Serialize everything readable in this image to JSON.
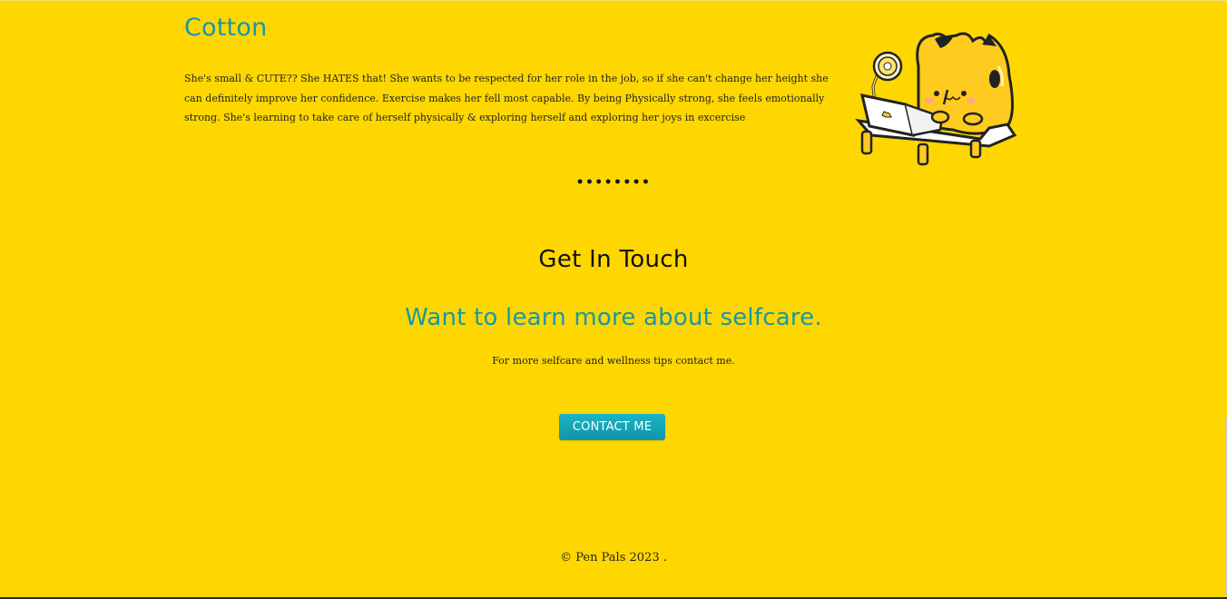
{
  "profile": {
    "name": "Cotton",
    "description": "She's small & CUTE?? She HATES that! She wants to be respected for her role in the job, so if she can't change her height she can definitely improve her confidence. Exercise makes her fell most capable. By being Physically strong, she feels emotionally strong. She's learning to take care of herself physically & exploring herself and exploring her joys in excercise"
  },
  "divider": "••••••••",
  "contact": {
    "heading": "Get In Touch",
    "subheading": "Want to learn more about selfcare.",
    "text": "For more selfcare and wellness tips contact me.",
    "button_label": "CONTACT ME"
  },
  "footer": {
    "copyright": "© Pen Pals 2023 ."
  },
  "colors": {
    "background": "#ffd700",
    "accent": "#1599a8",
    "button": "#1ab4c6"
  }
}
